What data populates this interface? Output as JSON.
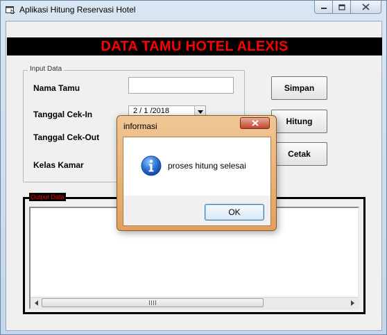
{
  "window": {
    "title": "Aplikasi Hitung Reservasi Hotel"
  },
  "banner": {
    "title": "DATA TAMU HOTEL ALEXIS",
    "text_color": "#ff0000",
    "background": "#000000"
  },
  "input_group": {
    "legend": "Input Data",
    "labels": {
      "nama_tamu": "Nama Tamu",
      "tanggal_cek_in": "Tanggal Cek-In",
      "tanggal_cek_out": "Tanggal Cek-Out",
      "kelas_kamar": "Kelas Kamar"
    },
    "values": {
      "nama_tamu": "",
      "tanggal_cek_in": "2 / 1 /2018"
    }
  },
  "buttons": {
    "simpan": "Simpan",
    "hitung": "Hitung",
    "cetak": "Cetak"
  },
  "output_group": {
    "legend": "Output Data",
    "content": ""
  },
  "dialog": {
    "title": "informasi",
    "message": "proses hitung selesai",
    "ok_label": "OK",
    "icon": "information-icon"
  },
  "icons": {
    "minimize": "minimize-icon",
    "maximize": "maximize-icon",
    "close": "close-icon",
    "dropdown": "chevron-down-icon"
  }
}
